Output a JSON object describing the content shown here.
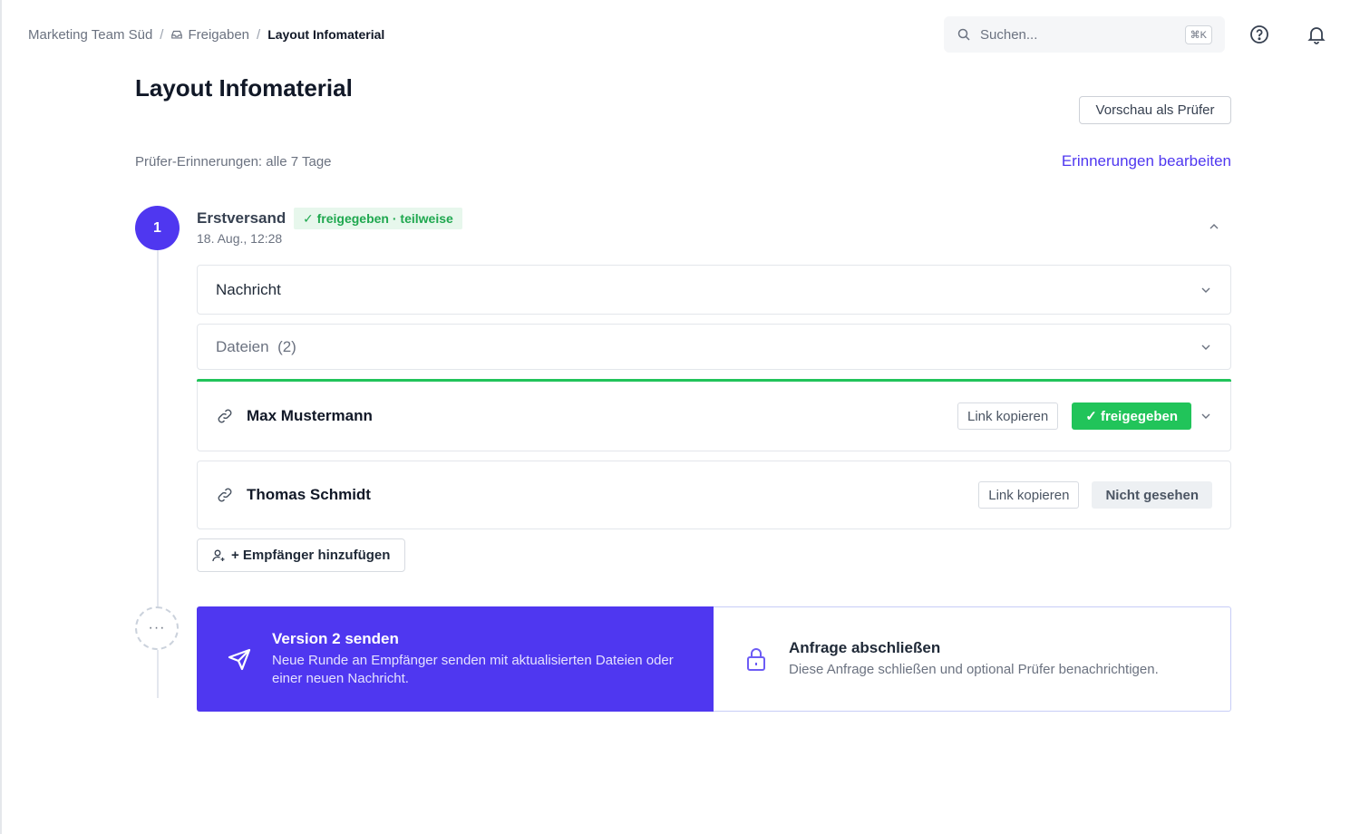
{
  "breadcrumb": {
    "team": "Marketing Team Süd",
    "section": "Freigaben",
    "current": "Layout Infomaterial",
    "separator": "/"
  },
  "search": {
    "placeholder": "Suchen...",
    "shortcut": "⌘K"
  },
  "page": {
    "title": "Layout Infomaterial",
    "preview_button": "Vorschau als Prüfer",
    "reminder_text": "Prüfer-Erinnerungen: alle 7 Tage",
    "reminder_link": "Erinnerungen bearbeiten"
  },
  "round": {
    "number": "1",
    "name": "Erstversand",
    "status": "✓ freigegeben · teilweise",
    "date": "18. Aug., 12:28",
    "message_label": "Nachricht",
    "files_label": "Dateien",
    "files_count": "(2)"
  },
  "recipients": [
    {
      "name": "Max Mustermann",
      "copy_label": "Link kopieren",
      "status": "✓ freigegeben"
    },
    {
      "name": "Thomas Schmidt",
      "copy_label": "Link kopieren",
      "status": "Nicht gesehen"
    }
  ],
  "add_recipient": "+ Empfänger hinzufügen",
  "more_dots": "···",
  "actions": {
    "send": {
      "title": "Version 2 senden",
      "description": "Neue Runde an Empfänger senden mit aktualisierten Dateien oder einer neuen Nachricht."
    },
    "close": {
      "title": "Anfrage abschließen",
      "description": "Diese Anfrage schließen und optional Prüfer benachrichtigen."
    }
  },
  "colors": {
    "accent": "#4f37f0",
    "success": "#21c45a",
    "success_bg": "#e7f7ec"
  }
}
